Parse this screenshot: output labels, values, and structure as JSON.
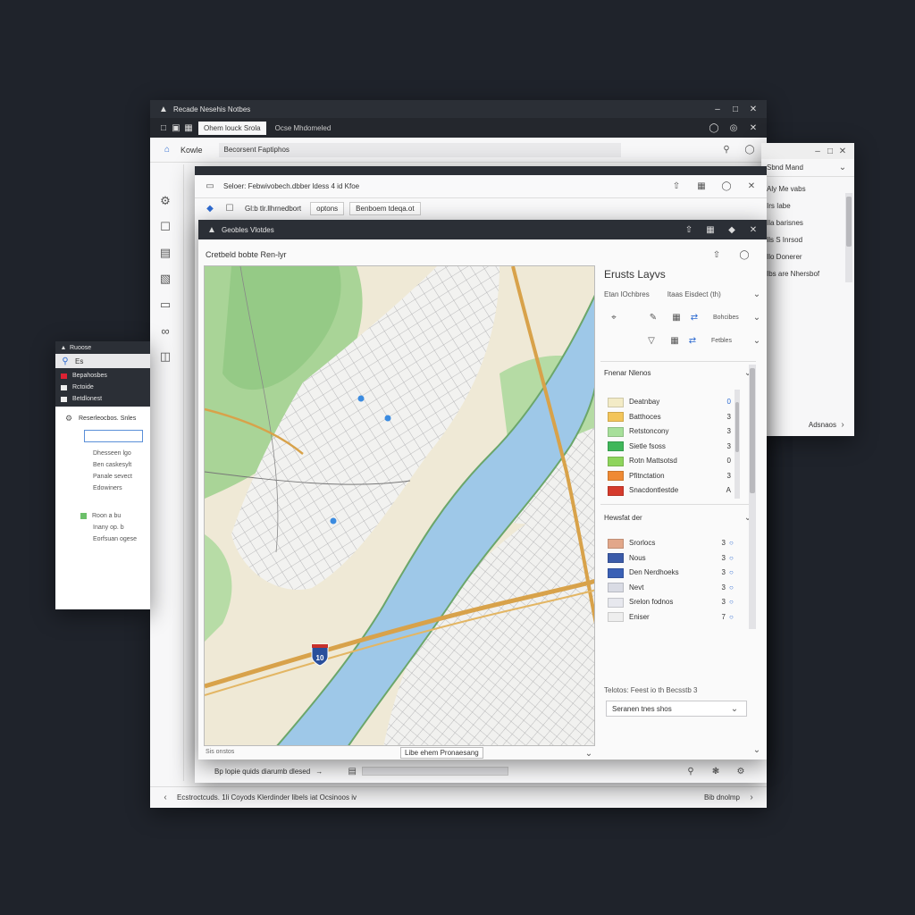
{
  "main_window": {
    "title": "Recade Nesehis Notbes",
    "tabs": [
      "Ohem louck Srola",
      "Ocse Mhdomeled"
    ],
    "nav_label": "Kowle",
    "search_value": "Becorsent Faptiphos",
    "status_text": "Ecstroctcuds. 1li Coyods Klerdinder libels iat Ocsinoos iv",
    "status_right": "Bib dnolmp"
  },
  "left_rail_icons": [
    "gear-icon",
    "box-icon",
    "inbox-icon",
    "image-icon",
    "folder-icon",
    "share-icon",
    "database-icon"
  ],
  "inner_window": {
    "path": "Seloer: Febwivobech.dbber ldess 4 id Kfoe",
    "tab_labels": [
      "Gl:b tlr.llhrnedbort",
      "optons",
      "Benboem tdeqa.ot"
    ]
  },
  "map_window": {
    "title": "Geobles Vlotdes",
    "map_heading": "Cretbeld bobte Ren-lyr",
    "map_footer": "Sis onstos",
    "map_tooltip": "Libe ehem Pronaesang",
    "scale_label": "Bp lopie quids diarumb dlesed",
    "highway_shield": "10"
  },
  "layers_panel": {
    "title": "Erusts Layvs",
    "filter_left": "Etan lOchbres",
    "filter_right": "Itaas Eisdect (th)",
    "tool_row1_label": "Bohcibes",
    "tool_row2_label": "Fetbles",
    "section1_title": "Fnenar Nlenos",
    "section1_items": [
      {
        "label": "Deatnbay",
        "color": "#f3ebc6",
        "count": "0"
      },
      {
        "label": "Batthoces",
        "color": "#f3c55a",
        "count": "3"
      },
      {
        "label": "Retstoncony",
        "color": "#a6df9a",
        "count": "3"
      },
      {
        "label": "Sietle fsoss",
        "color": "#3fb75a",
        "count": "3"
      },
      {
        "label": "Rotn Mattsotsd",
        "color": "#8ed45c",
        "count": "0"
      },
      {
        "label": "Pfitnctation",
        "color": "#ef8a34",
        "count": "3"
      },
      {
        "label": "Snacdontlestde",
        "color": "#d53b2c",
        "count": "A"
      }
    ],
    "section2_title": "Hewsfat der",
    "section2_items": [
      {
        "label": "Srorlocs",
        "color": "#e2a78a",
        "count": "3"
      },
      {
        "label": "Nous",
        "color": "#3b5ba9",
        "count": "3"
      },
      {
        "label": "Den Nerdhoeks",
        "color": "#3a60b5",
        "count": "3"
      },
      {
        "label": "Nevt",
        "color": "#d9dbe4",
        "count": "3"
      },
      {
        "label": "Srelon fodnos",
        "color": "#e7e8ee",
        "count": "3"
      },
      {
        "label": "Eniser",
        "color": "#eeeeee",
        "count": "7"
      }
    ],
    "bottom_label": "Telotos: Feest io th Becsstb 3",
    "dropdown_value": "Seranen tnes shos"
  },
  "right_window": {
    "title": "Sbnd Mand",
    "items": [
      "Aly Me vabs",
      "Irs Iabe",
      "Ila barisnes",
      "Ils S Inrsod",
      "Ilo Donerer",
      "Ibs are Nhersbof"
    ],
    "footer": "Adsnaos"
  },
  "left_window": {
    "title": "Ruoose",
    "search": "Es",
    "menu": [
      "Bepahosbes",
      "Rctoide",
      "Betdlonest"
    ],
    "section_title": "Reserleocbos. Snles",
    "list1": [
      "Dhesseen lgo",
      "Ben caskesylt",
      "Panale sevect",
      "Edowiners"
    ],
    "list2": [
      "Roon a bu",
      "Inany op. b",
      "Eorfsuan ogese"
    ]
  }
}
